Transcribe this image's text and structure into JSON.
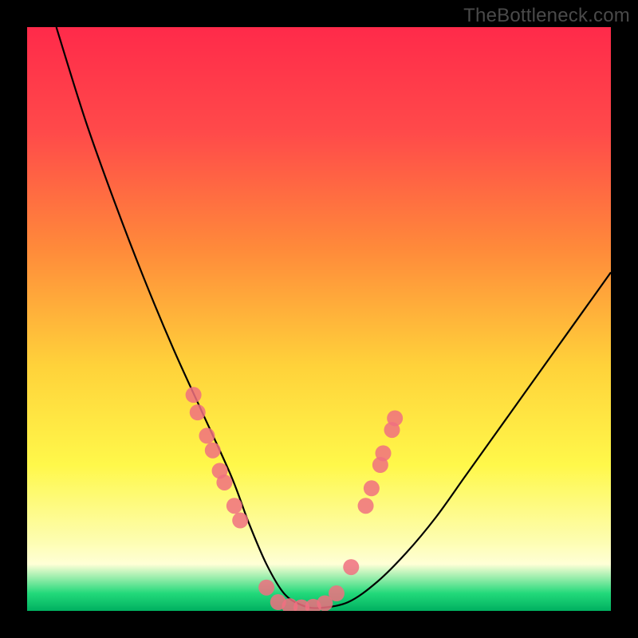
{
  "watermark": "TheBottleneck.com",
  "chart_data": {
    "type": "line",
    "title": "",
    "xlabel": "",
    "ylabel": "",
    "xlim": [
      0,
      100
    ],
    "ylim": [
      0,
      100
    ],
    "grid": false,
    "legend": null,
    "series": [
      {
        "name": "bottleneck-curve",
        "x": [
          5,
          10,
          15,
          20,
          25,
          30,
          35,
          38,
          41,
          44,
          47,
          50,
          55,
          60,
          65,
          70,
          75,
          80,
          85,
          90,
          95,
          100
        ],
        "y": [
          100,
          84,
          70,
          57,
          45,
          34,
          23,
          15,
          8,
          3,
          1,
          0.5,
          1.5,
          5,
          10,
          16,
          23,
          30,
          37,
          44,
          51,
          58
        ]
      }
    ],
    "markers_left": {
      "name": "left-cluster",
      "color": "#f07080",
      "points": [
        {
          "x": 28.5,
          "y": 37.0
        },
        {
          "x": 29.2,
          "y": 34.0
        },
        {
          "x": 30.8,
          "y": 30.0
        },
        {
          "x": 31.8,
          "y": 27.5
        },
        {
          "x": 33.0,
          "y": 24.0
        },
        {
          "x": 33.8,
          "y": 22.0
        },
        {
          "x": 35.5,
          "y": 18.0
        },
        {
          "x": 36.5,
          "y": 15.5
        }
      ]
    },
    "markers_right": {
      "name": "right-cluster",
      "color": "#f07080",
      "points": [
        {
          "x": 58.0,
          "y": 18.0
        },
        {
          "x": 59.0,
          "y": 21.0
        },
        {
          "x": 60.5,
          "y": 25.0
        },
        {
          "x": 61.0,
          "y": 27.0
        },
        {
          "x": 62.5,
          "y": 31.0
        },
        {
          "x": 63.0,
          "y": 33.0
        }
      ]
    },
    "markers_bottom": {
      "name": "bottom-cluster",
      "color": "#f07080",
      "points": [
        {
          "x": 41.0,
          "y": 4.0
        },
        {
          "x": 43.0,
          "y": 1.5
        },
        {
          "x": 45.0,
          "y": 0.8
        },
        {
          "x": 47.0,
          "y": 0.6
        },
        {
          "x": 49.0,
          "y": 0.7
        },
        {
          "x": 51.0,
          "y": 1.3
        },
        {
          "x": 53.0,
          "y": 3.0
        },
        {
          "x": 55.5,
          "y": 7.5
        }
      ]
    }
  }
}
